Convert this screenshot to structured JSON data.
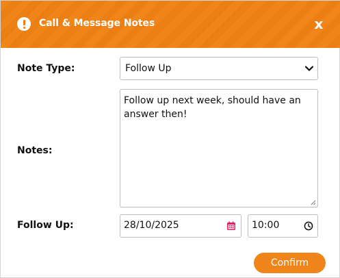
{
  "dialog": {
    "title": "Call & Message Notes",
    "close_label": "x"
  },
  "form": {
    "note_type_label": "Note Type:",
    "note_type_value": "Follow Up",
    "notes_label": "Notes:",
    "notes_value": "Follow up next week, should have an answer then!",
    "follow_up_label": "Follow Up:",
    "follow_up_date": "28/10/2025",
    "follow_up_time": "10:00"
  },
  "actions": {
    "confirm_label": "Confirm"
  },
  "colors": {
    "header": "#ec7f14",
    "accent": "#ef851a",
    "calendar_icon": "#e0245e"
  }
}
